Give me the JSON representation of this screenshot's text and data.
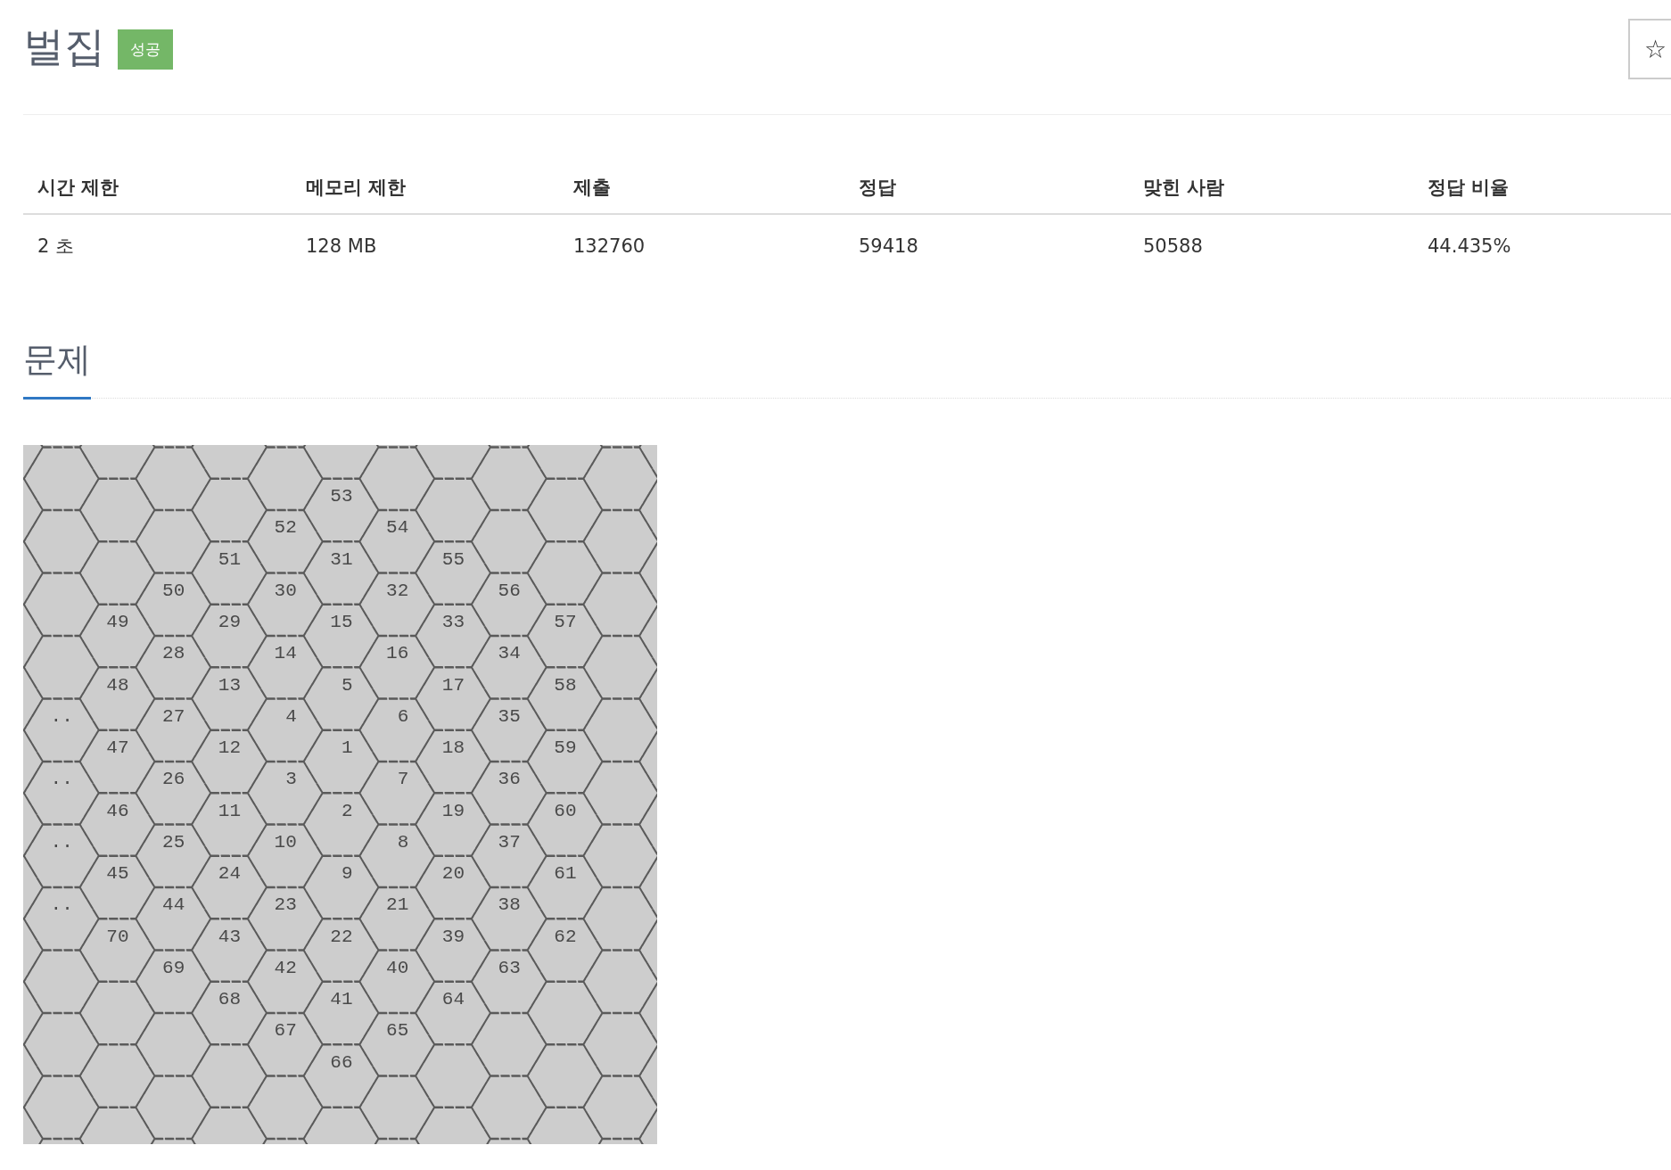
{
  "problem": {
    "title": "벌집",
    "badge": "성공",
    "star_button": "☆"
  },
  "info_table": {
    "columns": [
      "시간 제한",
      "메모리 제한",
      "제출",
      "정답",
      "맞힌 사람",
      "정답 비율"
    ],
    "rows": [
      [
        "2 초",
        "128 MB",
        "132760",
        "59418",
        "50588",
        "44.435%"
      ]
    ]
  },
  "section": {
    "heading": "문제"
  },
  "diagram": {
    "columns": [
      {
        "cells": [
          null,
          null,
          null,
          "..",
          "..",
          "..",
          ".."
        ]
      },
      {
        "cells": [
          null,
          null,
          "49",
          "48",
          "47",
          "46",
          "45",
          "70"
        ]
      },
      {
        "cells": [
          null,
          "50",
          "28",
          "27",
          "26",
          "25",
          "44",
          "69"
        ]
      },
      {
        "cells": [
          null,
          "51",
          "29",
          "13",
          "12",
          "11",
          "24",
          "43",
          "68"
        ]
      },
      {
        "cells": [
          "52",
          "30",
          "14",
          "4",
          "3",
          "10",
          "23",
          "42",
          "67"
        ]
      },
      {
        "cells": [
          "53",
          "31",
          "15",
          "5",
          "1",
          "2",
          "9",
          "22",
          "41",
          "66"
        ]
      },
      {
        "cells": [
          "54",
          "32",
          "16",
          "6",
          "7",
          "8",
          "21",
          "40",
          "65"
        ]
      },
      {
        "cells": [
          null,
          "55",
          "33",
          "17",
          "18",
          "19",
          "20",
          "39",
          "64"
        ]
      },
      {
        "cells": [
          null,
          "56",
          "34",
          "35",
          "36",
          "37",
          "38",
          "63"
        ]
      },
      {
        "cells": [
          null,
          null,
          "57",
          "58",
          "59",
          "60",
          "61",
          "62"
        ]
      }
    ]
  }
}
